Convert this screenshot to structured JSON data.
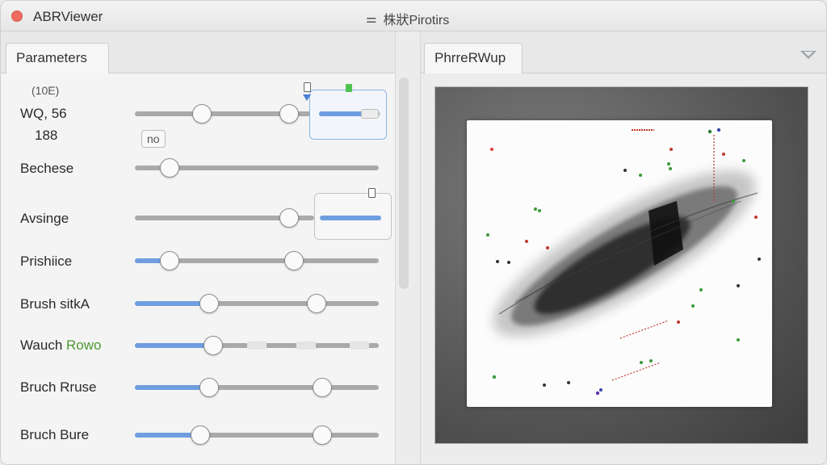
{
  "window": {
    "app_title": "ABRViewer",
    "center_icon": "sliders-icon",
    "center_title": "株狀Pirotirs"
  },
  "left_tabs": [
    {
      "label": "Parameters"
    }
  ],
  "right_tabs": [
    {
      "label": "PhrreRWup"
    }
  ],
  "params": {
    "top_small": "10E",
    "wq_label": "WQ, 56",
    "wq_value": "188",
    "small_box": "no",
    "rows": [
      {
        "label": "Bechese"
      },
      {
        "label": "Avsinge"
      },
      {
        "label": "Prishiice"
      },
      {
        "label": "Brush sitkA"
      },
      {
        "label_a": "Wauch ",
        "label_b": "Rowo"
      },
      {
        "label": "Bruch Rruse"
      },
      {
        "label": "Bruch Bure"
      }
    ]
  },
  "colors": {
    "accent": "#6f9ee0",
    "close": "#ee6b5f",
    "green_text": "#4b9a2f"
  }
}
